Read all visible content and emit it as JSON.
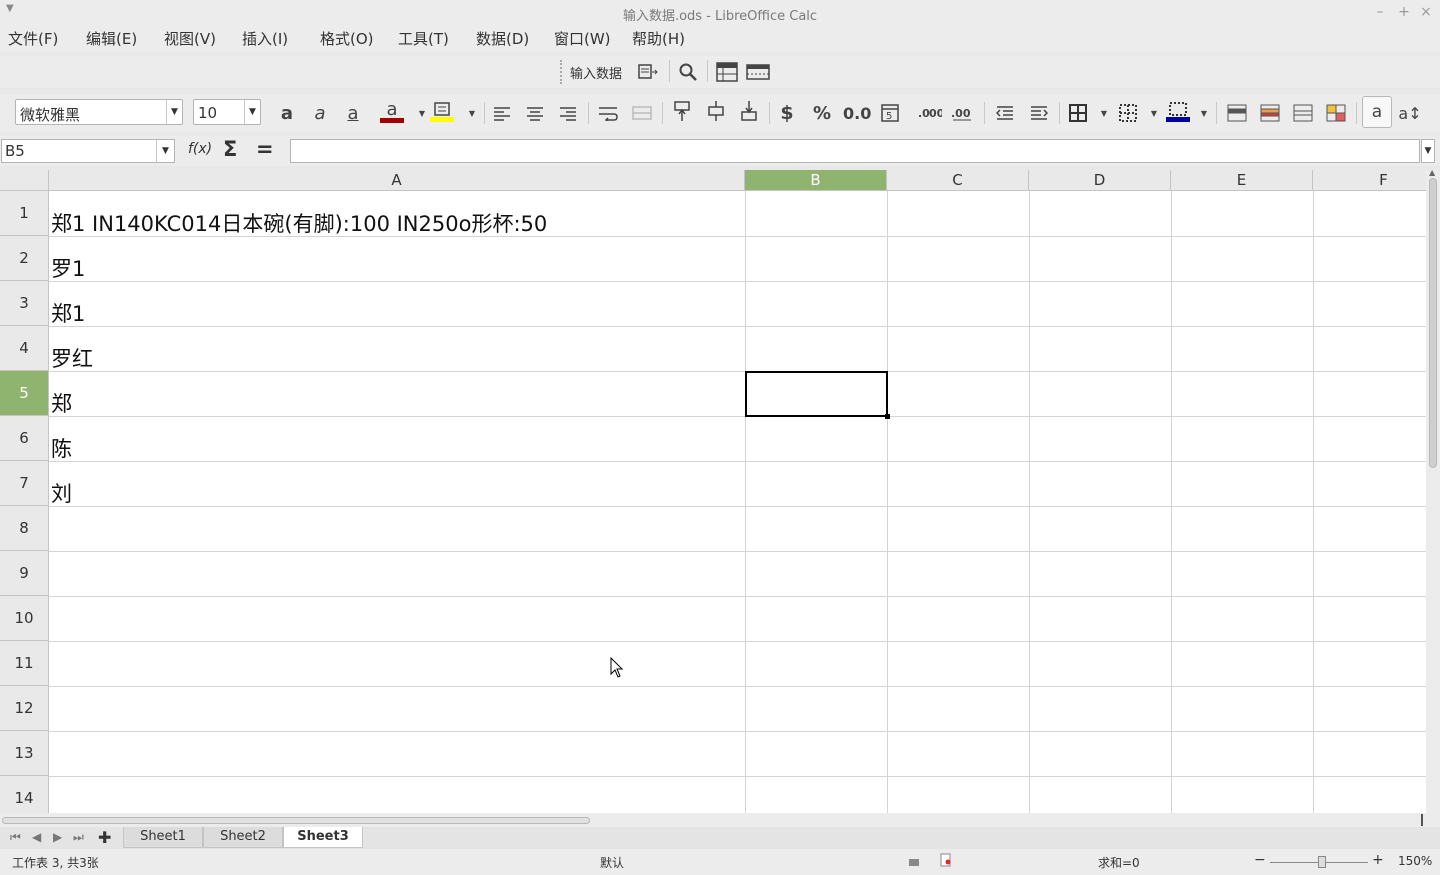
{
  "window": {
    "title": "输入数据.ods - LibreOffice Calc",
    "minimize": "–",
    "maximize": "+",
    "close": "×"
  },
  "menu": [
    "文件(F)",
    "编辑(E)",
    "视图(V)",
    "插入(I)",
    "格式(O)",
    "工具(T)",
    "数据(D)",
    "窗口(W)",
    "帮助(H)"
  ],
  "toolbar1": {
    "input_data_label": "输入数据"
  },
  "toolbar2": {
    "font_name": "微软雅黑",
    "font_size": "10",
    "font_color_hex": "#a00000",
    "highlight_color_hex": "#ffff00",
    "border_color_hex": "#0000a0",
    "currency_symbol": "$",
    "percent_symbol": "%",
    "number_format": "0.0"
  },
  "formula_bar": {
    "name_box": "B5",
    "fx_label": "f(x)",
    "sum_symbol": "Σ",
    "equals_symbol": "=",
    "content": ""
  },
  "grid": {
    "columns": [
      "A",
      "B",
      "C",
      "D",
      "E",
      "F"
    ],
    "selected_column": "B",
    "selected_row": "5",
    "rows": [
      "1",
      "2",
      "3",
      "4",
      "5",
      "6",
      "7",
      "8",
      "9",
      "10",
      "11",
      "12",
      "13",
      "14"
    ],
    "cells_A": [
      "郑1  IN140KC014日本碗(有脚):100  IN250o形杯:50",
      "罗1",
      "郑1",
      "罗红",
      "郑",
      "陈",
      "刘"
    ],
    "selection_color": "#8fb46f"
  },
  "sheets": {
    "tabs": [
      "Sheet1",
      "Sheet2",
      "Sheet3"
    ],
    "active": "Sheet3",
    "add_icon": "✚"
  },
  "statusbar": {
    "sheet_info": "工作表 3, 共3张",
    "page_style": "默认",
    "sum_text": "求和=0",
    "zoom": "150%"
  }
}
